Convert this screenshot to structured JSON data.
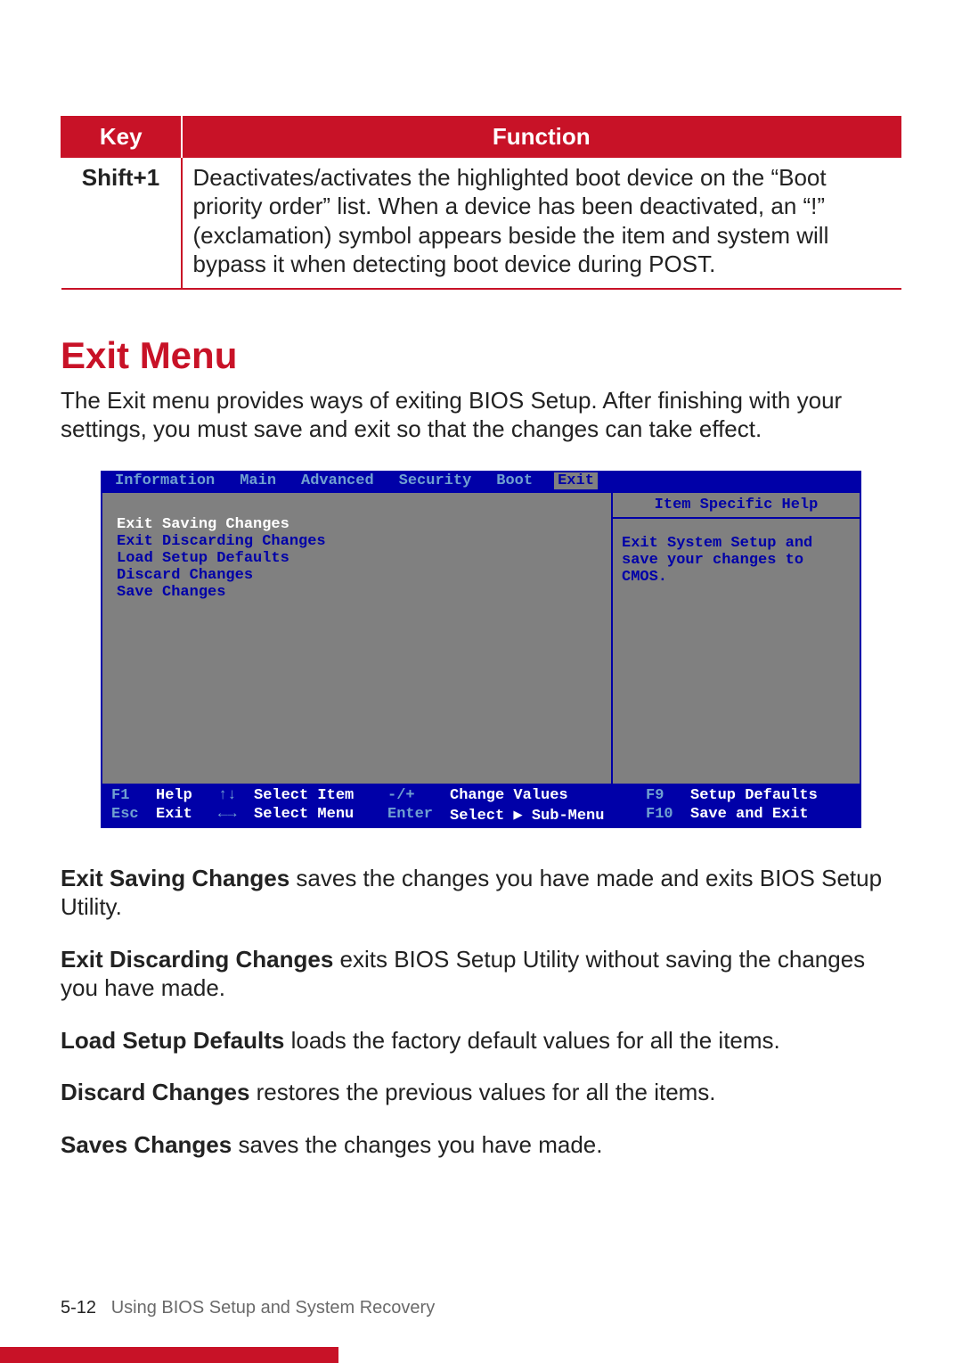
{
  "table": {
    "headers": {
      "key": "Key",
      "function": "Function"
    },
    "rows": [
      {
        "key": "Shift+1",
        "function": "Deactivates/activates the highlighted boot device on the “Boot priority order” list. When a device has been deactivated, an “!” (exclamation) symbol appears beside the item and system will bypass it when detecting boot device during POST."
      }
    ]
  },
  "heading": "Exit Menu",
  "intro": "The Exit menu provides ways of exiting BIOS Setup. After finishing with your settings, you must save and exit so that the changes can take effect.",
  "bios": {
    "tabs": [
      "Information",
      "Main",
      "Advanced",
      "Security",
      "Boot",
      "Exit"
    ],
    "active_tab": "Exit",
    "items": [
      {
        "label": "Exit Saving Changes",
        "selected": true
      },
      {
        "label": "Exit Discarding Changes",
        "selected": false
      },
      {
        "label": "Load Setup Defaults",
        "selected": false
      },
      {
        "label": "Discard Changes",
        "selected": false
      },
      {
        "label": "Save Changes",
        "selected": false
      }
    ],
    "help_title": "Item Specific Help",
    "help_body": "Exit System Setup and save your changes to CMOS.",
    "footer": {
      "f1": {
        "key": "F1",
        "label": "Help"
      },
      "updown": {
        "key": "↑↓",
        "label": "Select Item"
      },
      "plusminus": {
        "key": "-/+",
        "label": "Change Values"
      },
      "f9": {
        "key": "F9",
        "label": "Setup Defaults"
      },
      "esc": {
        "key": "Esc",
        "label": "Exit"
      },
      "leftright": {
        "key": "←→",
        "label": "Select Menu"
      },
      "enter": {
        "key": "Enter",
        "label": "Select ▶ Sub-Menu"
      },
      "f10": {
        "key": "F10",
        "label": "Save and Exit"
      }
    }
  },
  "definitions": [
    {
      "term": "Exit Saving Changes",
      "desc": "  saves the changes you have made and exits BIOS Setup Utility."
    },
    {
      "term": "Exit Discarding Changes",
      "desc": "  exits BIOS Setup Utility without saving the changes you have made."
    },
    {
      "term": "Load Setup Defaults",
      "desc": "  loads the factory default values for all the items."
    },
    {
      "term": "Discard Changes",
      "desc": "  restores the previous values for all the items."
    },
    {
      "term": "Saves Changes",
      "desc": "  saves the changes you have made."
    }
  ],
  "footer": {
    "page_num": "5-12",
    "section": "Using BIOS Setup and System Recovery"
  }
}
